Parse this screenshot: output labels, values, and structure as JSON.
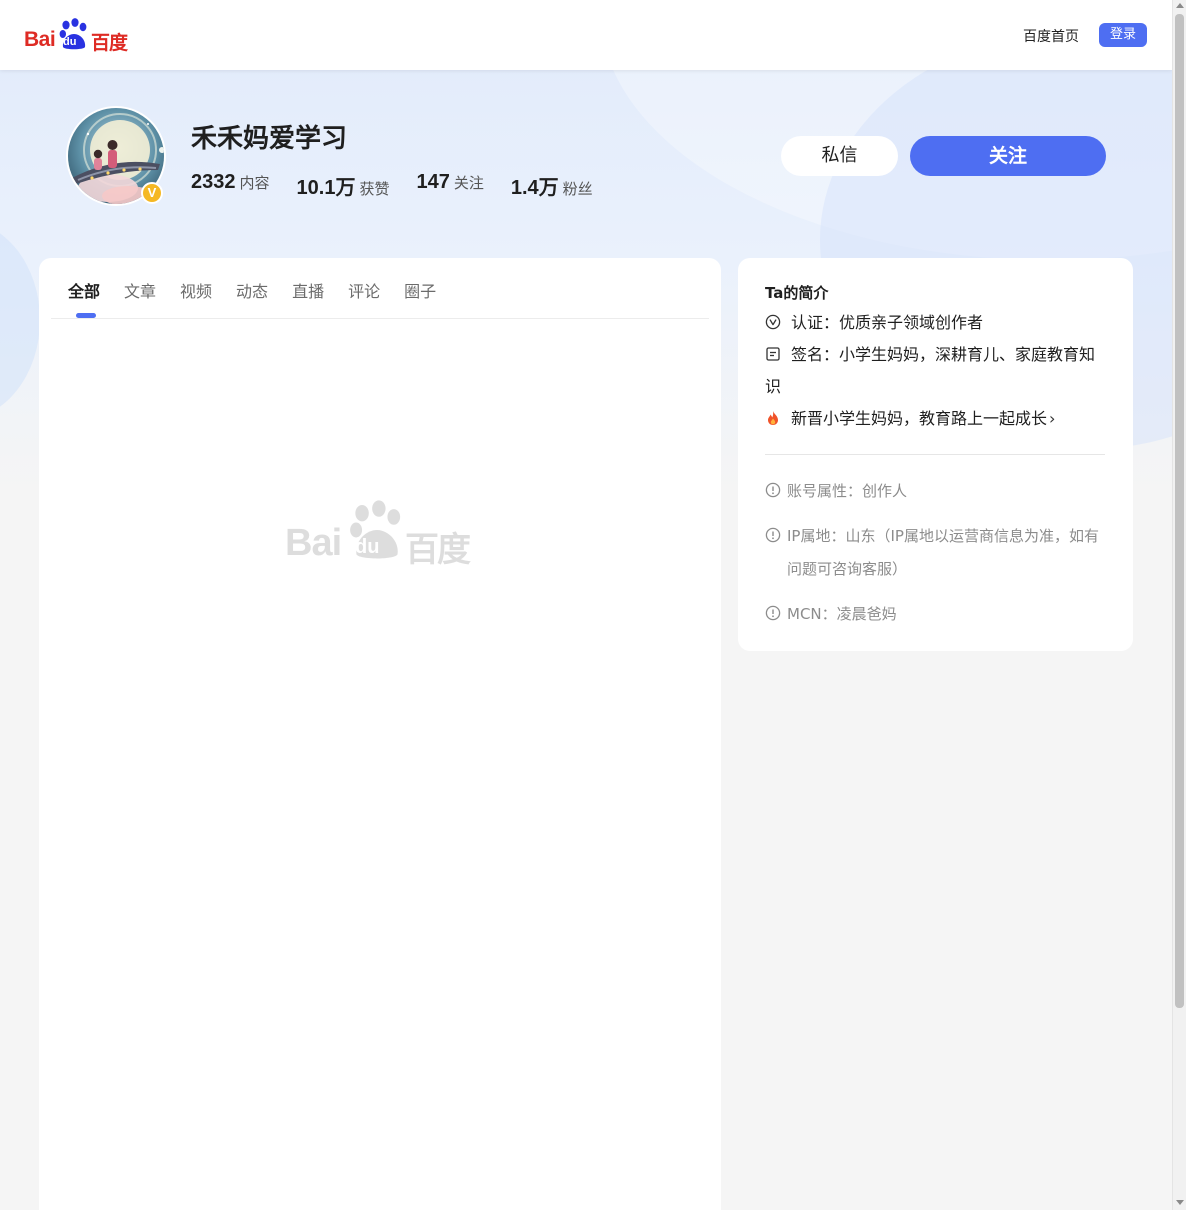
{
  "header": {
    "logo_latin": "Bai",
    "logo_du": "du",
    "logo_cn": "百度",
    "home_link": "百度首页",
    "login_button": "登录"
  },
  "profile": {
    "name": "禾禾妈爱学习",
    "badge": "V",
    "stats": [
      {
        "value": "2332",
        "label": "内容"
      },
      {
        "value": "10.1万",
        "label": "获赞"
      },
      {
        "value": "147",
        "label": "关注"
      },
      {
        "value": "1.4万",
        "label": "粉丝"
      }
    ],
    "message_button": "私信",
    "follow_button": "关注"
  },
  "tabs": [
    {
      "label": "全部",
      "active": true
    },
    {
      "label": "文章",
      "active": false
    },
    {
      "label": "视频",
      "active": false
    },
    {
      "label": "动态",
      "active": false
    },
    {
      "label": "直播",
      "active": false
    },
    {
      "label": "评论",
      "active": false
    },
    {
      "label": "圈子",
      "active": false
    }
  ],
  "watermark": {
    "latin": "Bai",
    "du": "du",
    "cn": "百度"
  },
  "intro": {
    "title": "Ta的简介",
    "certification": "认证：优质亲子领域创作者",
    "signature": "签名：小学生妈妈，深耕育儿、家庭教育知识",
    "honor": "新晋小学生妈妈，教育路上一起成长",
    "honor_chevron": "›",
    "account_type": "账号属性：创作人",
    "ip_location": "IP属地：山东（IP属地以运营商信息为准，如有问题可咨询客服）",
    "mcn": "MCN：凌晨爸妈"
  },
  "colors": {
    "accent": "#4e6ef2",
    "brand_red": "#de2b24",
    "badge_gold": "#f5b824"
  }
}
